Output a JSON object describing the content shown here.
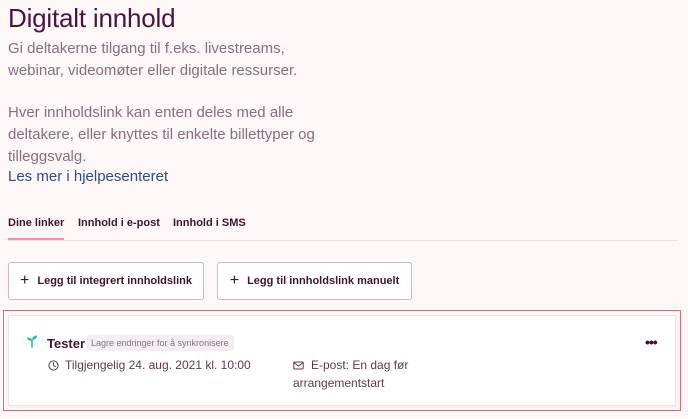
{
  "page": {
    "title": "Digitalt innhold",
    "description_1": "Gi deltakerne tilgang til f.eks. livestreams, webinar, videomøter eller digitale ressurser.",
    "description_2": "Hver innholdslink kan enten deles med alle deltakere, eller knyttes til enkelte billettyper og tilleggsvalg.",
    "help_link": "Les mer i hjelpesenteret"
  },
  "tabs": [
    {
      "label": "Dine linker",
      "active": true
    },
    {
      "label": "Innhold i e-post",
      "active": false
    },
    {
      "label": "Innhold i SMS",
      "active": false
    }
  ],
  "actions": {
    "add_integrated": "Legg til integrert innholdslink",
    "add_manual": "Legg til innholdslink manuelt"
  },
  "link_card": {
    "name": "Tester",
    "badge": "Lagre endringer for å synkronisere",
    "more": "•••",
    "availability": "Tilgjengelig 24. aug. 2021 kl. 10:00",
    "email_line1": "E-post: En dag før",
    "email_line2": "arrangementstart"
  },
  "colors": {
    "accent": "#f58fa8",
    "link": "#2b4c8c",
    "brand_dark": "#3d1431",
    "highlight": "#e06a6a",
    "icon_teal": "#2bbfb0"
  },
  "icons": {
    "card_icon": "sprout-icon",
    "availability_icon": "clock-icon",
    "email_icon": "mail-icon"
  }
}
